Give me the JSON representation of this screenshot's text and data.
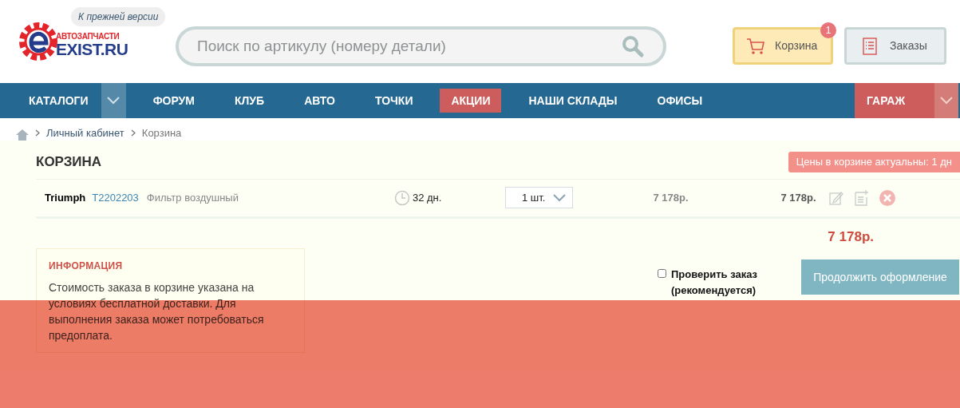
{
  "header": {
    "old_version_link": "К прежней версии",
    "logo": {
      "tagline": "АВТОЗАПЧАСТИ",
      "name": "EXIST.RU"
    },
    "search": {
      "placeholder": "Поиск по артикулу (номеру детали)"
    },
    "cart_button": {
      "label": "Корзина",
      "badge": "1"
    },
    "orders_button": {
      "label": "Заказы"
    }
  },
  "nav": {
    "items": [
      {
        "label": "КАТАЛОГИ",
        "kind": "dropdown",
        "selected": false
      },
      {
        "label": "ФОРУМ",
        "kind": "link",
        "selected": false
      },
      {
        "label": "КЛУБ",
        "kind": "link",
        "selected": false
      },
      {
        "label": "АВТО",
        "kind": "link",
        "selected": false
      },
      {
        "label": "ТОЧКИ",
        "kind": "link",
        "selected": false
      },
      {
        "label": "АКЦИИ",
        "kind": "link",
        "selected": true
      },
      {
        "label": "НАШИ СКЛАДЫ",
        "kind": "link",
        "selected": false
      },
      {
        "label": "ОФИСЫ",
        "kind": "link",
        "selected": false
      }
    ],
    "garage": "ГАРАЖ"
  },
  "breadcrumbs": [
    "Личный кабинет",
    "Корзина"
  ],
  "cart": {
    "title": "КОРЗИНА",
    "price_notice": "Цены в корзине актуальны: 1 дн",
    "items": [
      {
        "brand": "Triumph",
        "article": "T2202203",
        "description": "Фильтр воздушный",
        "delivery": "32 дн.",
        "quantity": "1 шт.",
        "price": "7 178р.",
        "sum": "7 178р."
      }
    ],
    "total": "7 178р.",
    "info": {
      "title": "ИНФОРМАЦИЯ",
      "text": "Стоимость заказа в корзине указана на условиях бесплатной доставки. Для выполнения заказа может потребоваться предоплата."
    },
    "check_order": {
      "label": "Проверить заказ (рекомендуется)",
      "checked": false
    },
    "continue_button": "Продолжить оформление"
  }
}
